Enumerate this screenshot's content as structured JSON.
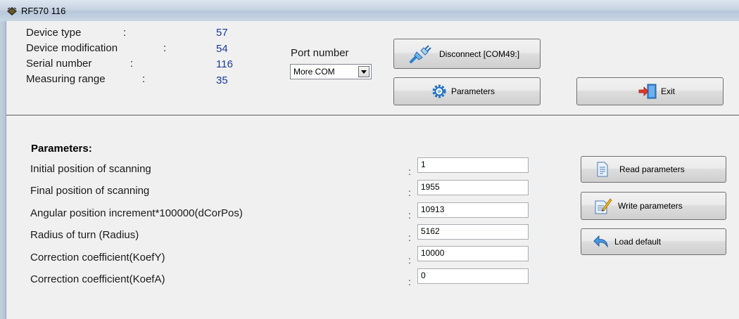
{
  "window": {
    "title": "RF570 116"
  },
  "device_info": [
    {
      "label": "Device type",
      "colon": ":",
      "value": "57"
    },
    {
      "label": "Device modification",
      "colon": ":",
      "value": "54"
    },
    {
      "label": "Serial number",
      "colon": ":",
      "value": "116"
    },
    {
      "label": "Measuring range",
      "colon": ":",
      "value": "35"
    }
  ],
  "port": {
    "label": "Port number",
    "selected": "More COM"
  },
  "buttons": {
    "disconnect": "Disconnect [COM49:]",
    "parameters": "Parameters",
    "exit": "Exit",
    "read": "Read parameters",
    "write": "Write parameters",
    "load_default": "Load default"
  },
  "params": {
    "heading": "Parameters:",
    "rows": [
      {
        "label": "Initial position of scanning",
        "value": "1"
      },
      {
        "label": "Final position of scanning",
        "value": "1955"
      },
      {
        "label": "Angular position increment*100000(dCorPos)",
        "value": "10913"
      },
      {
        "label": "Radius of turn (Radius)",
        "value": "5162"
      },
      {
        "label": "Correction coefficient(KoefY)",
        "value": "10000"
      },
      {
        "label": "Correction coefficient(KoefA)",
        "value": "0"
      }
    ],
    "colon": ":"
  },
  "colors": {
    "value_blue": "#1a3a9a",
    "panel": "#f0f0f0"
  }
}
